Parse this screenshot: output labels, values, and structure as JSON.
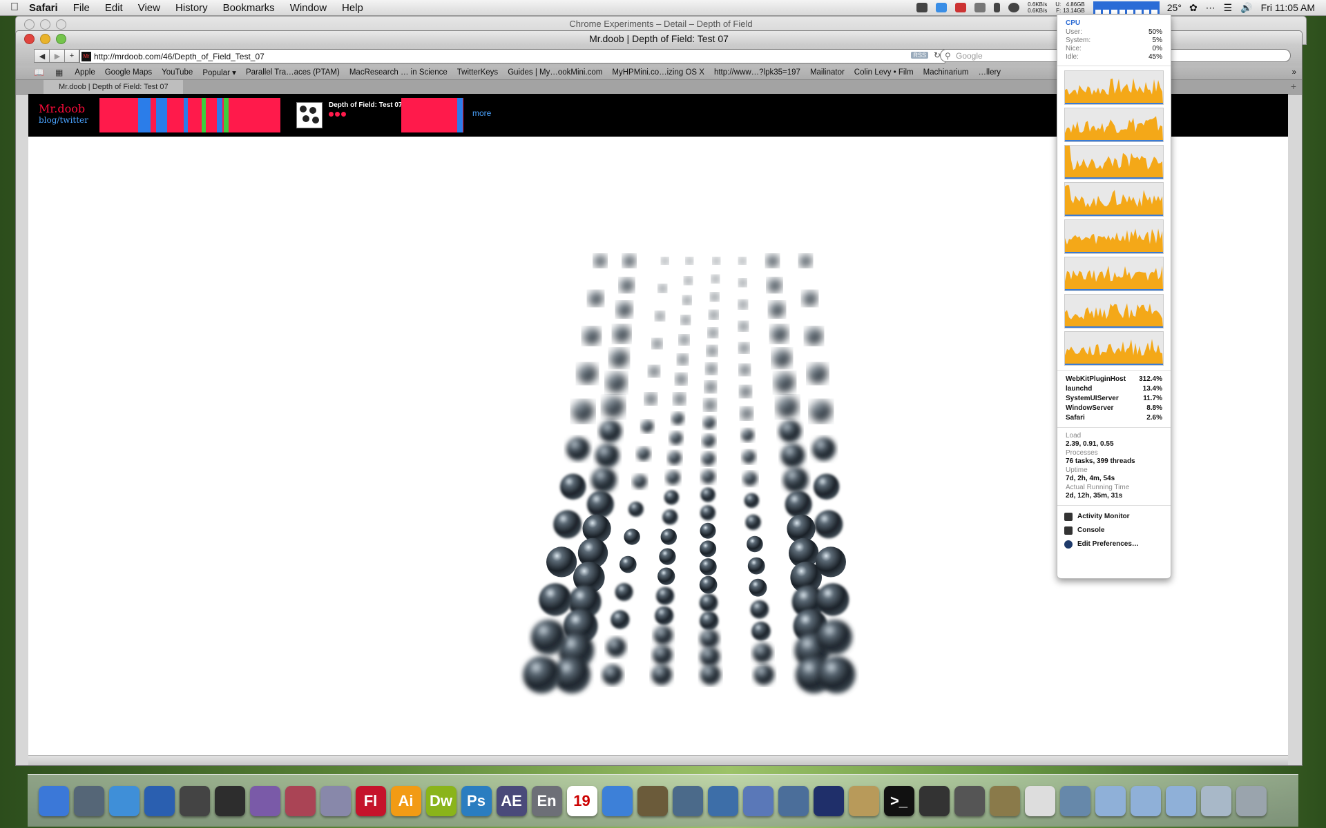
{
  "menubar": {
    "app": "Safari",
    "items": [
      "File",
      "Edit",
      "View",
      "History",
      "Bookmarks",
      "Window",
      "Help"
    ],
    "net_up": "0.6KB/s",
    "net_down": "0.6KB/s",
    "disk_used": "4.86GB",
    "disk_free": "13.14GB",
    "disk_used_prefix": "U:",
    "disk_free_prefix": "F:",
    "temperature": "25°",
    "clock": "Fri 11:05 AM"
  },
  "back_window": {
    "title": "Chrome Experiments – Detail – Depth of Field"
  },
  "window": {
    "title": "Mr.doob | Depth of Field: Test 07",
    "url": "http://mrdoob.com/46/Depth_of_Field_Test_07",
    "favicon_text": "Mr",
    "rss_label": "RSS",
    "search_placeholder": "Google",
    "bookmarks": [
      "Apple",
      "Google Maps",
      "YouTube",
      "Popular ▾",
      "Parallel Tra…aces (PTAM)",
      "MacResearch … in Science",
      "TwitterKeys",
      "Guides | My…ookMini.com",
      "MyHPMini.co…izing OS X",
      "http://www…?lpk35=197",
      "Mailinator",
      "Colin Levy • Film",
      "Machinarium",
      "…llery"
    ],
    "tab_title": "Mr.doob | Depth of Field: Test 07"
  },
  "site": {
    "logo": "Mr.doob",
    "logo_links": "blog/twitter",
    "demo_title": "Depth of Field: Test 07",
    "more": "more",
    "accent": "#ff1a4b",
    "link_color": "#4aa3ff"
  },
  "cpu_panel": {
    "header": "CPU",
    "stats": [
      {
        "label": "User:",
        "value": "50%"
      },
      {
        "label": "System:",
        "value": "5%"
      },
      {
        "label": "Nice:",
        "value": "0%"
      },
      {
        "label": "Idle:",
        "value": "45%"
      }
    ],
    "graphs": 8,
    "processes": [
      {
        "name": "WebKitPluginHost",
        "value": "312.4%"
      },
      {
        "name": "launchd",
        "value": "13.4%"
      },
      {
        "name": "SystemUIServer",
        "value": "11.7%"
      },
      {
        "name": "WindowServer",
        "value": "8.8%"
      },
      {
        "name": "Safari",
        "value": "2.6%"
      }
    ],
    "load_label": "Load",
    "load": "2.39, 0.91, 0.55",
    "processes_label": "Processes",
    "processes_value": "76 tasks, 399 threads",
    "uptime_label": "Uptime",
    "uptime": "7d, 2h, 4m, 54s",
    "running_label": "Actual Running Time",
    "running": "2d, 12h, 35m, 31s",
    "actions": [
      "Activity Monitor",
      "Console",
      "Edit Preferences…"
    ]
  },
  "dock": {
    "apps": [
      {
        "icon": "finder-icon",
        "label": "",
        "color": "#3b78d8"
      },
      {
        "icon": "time-machine-icon",
        "label": "",
        "color": "#556677"
      },
      {
        "icon": "safari-icon",
        "label": "",
        "color": "#3f8fd8"
      },
      {
        "icon": "globe-icon",
        "label": "",
        "color": "#2a5fb0"
      },
      {
        "icon": "clapper-icon",
        "label": "",
        "color": "#444444"
      },
      {
        "icon": "film-icon",
        "label": "",
        "color": "#2d2d2d"
      },
      {
        "icon": "disc-icon",
        "label": "",
        "color": "#7a5aa8"
      },
      {
        "icon": "colors-icon",
        "label": "",
        "color": "#aa4455"
      },
      {
        "icon": "dvd-icon",
        "label": "",
        "color": "#8888aa"
      },
      {
        "icon": "flash-icon",
        "label": "Fl",
        "color": "#c5132b"
      },
      {
        "icon": "illustrator-icon",
        "label": "Ai",
        "color": "#f29b14"
      },
      {
        "icon": "dreamweaver-icon",
        "label": "Dw",
        "color": "#8ab41a"
      },
      {
        "icon": "photoshop-icon",
        "label": "Ps",
        "color": "#2a7dc0"
      },
      {
        "icon": "after-effects-icon",
        "label": "AE",
        "color": "#4a4a7a"
      },
      {
        "icon": "encore-icon",
        "label": "En",
        "color": "#6d6f77"
      },
      {
        "icon": "calendar-icon",
        "label": "19",
        "color": "#ffffff"
      },
      {
        "icon": "itunes-icon",
        "label": "",
        "color": "#3d80d8"
      },
      {
        "icon": "preview-icon",
        "label": "",
        "color": "#6b5b3a"
      },
      {
        "icon": "iphoto-icon",
        "label": "",
        "color": "#4b6a8a"
      },
      {
        "icon": "xcode-icon",
        "label": "",
        "color": "#3d6ea8"
      },
      {
        "icon": "blueprint-icon",
        "label": "",
        "color": "#5a78b8"
      },
      {
        "icon": "simulator-icon",
        "label": "",
        "color": "#4b6e9a"
      },
      {
        "icon": "instruments-icon",
        "label": "",
        "color": "#1f2f6a"
      },
      {
        "icon": "builder-icon",
        "label": "",
        "color": "#b89a5a"
      },
      {
        "icon": "terminal-icon",
        "label": ">_",
        "color": "#111111"
      },
      {
        "icon": "unity-icon",
        "label": "",
        "color": "#333333"
      },
      {
        "icon": "unity-iphone-icon",
        "label": "",
        "color": "#555555"
      },
      {
        "icon": "truck-icon",
        "label": "",
        "color": "#8a7a4a"
      },
      {
        "icon": "textedit-icon",
        "label": "",
        "color": "#dddddd"
      },
      {
        "icon": "iphoto-share-icon",
        "label": "",
        "color": "#6688aa"
      },
      {
        "icon": "applications-folder-icon",
        "label": "",
        "color": "#8fb0d8"
      },
      {
        "icon": "downloads-folder-icon",
        "label": "",
        "color": "#8fb0d8"
      },
      {
        "icon": "documents-folder-icon",
        "label": "",
        "color": "#8fb0d8"
      },
      {
        "icon": "stack-icon",
        "label": "",
        "color": "#a8b8c8"
      },
      {
        "icon": "trash-icon",
        "label": "",
        "color": "#9aa4ad"
      }
    ]
  }
}
